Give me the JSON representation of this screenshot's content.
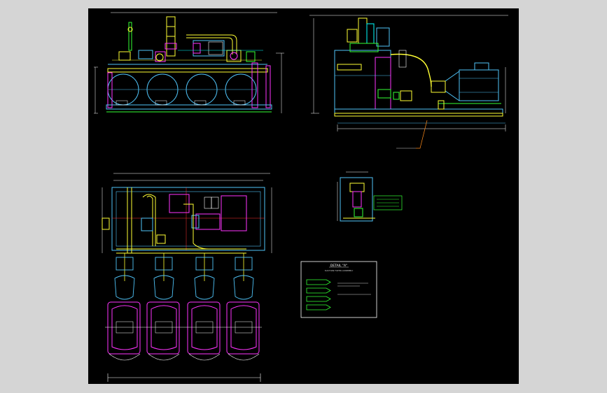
{
  "drawing": {
    "detail_title": "DETAIL \"A\"",
    "detail_subtitle": "SUCTION FILTER ASSEMBLY",
    "detail_tags": [
      "",
      "",
      "",
      ""
    ],
    "detail_notes": [
      "",
      ""
    ],
    "section_callout": "",
    "colors": {
      "background": "#000000",
      "frame": "#d5d5d5",
      "outline": "#4fc3f7",
      "piping": "#ffff33",
      "vessel": "#ff33ff",
      "dimension": "#ffffff",
      "valve": "#33ff33",
      "cyan": "#00ffff"
    }
  }
}
